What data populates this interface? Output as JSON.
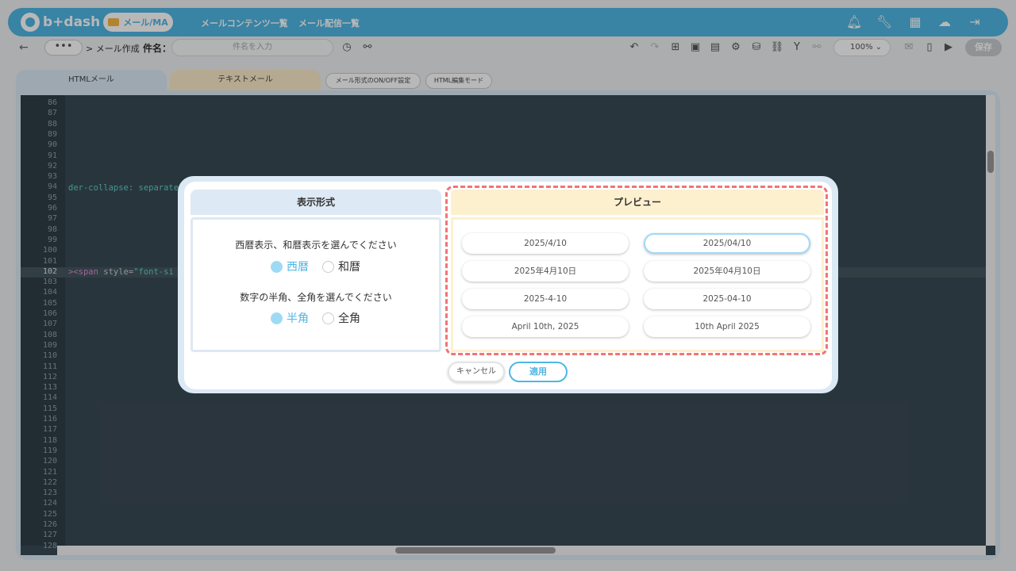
{
  "app": {
    "logo": "b+dash"
  },
  "topbar": {
    "mode": "メール/MA",
    "nav": [
      "メールコンテンツ一覧",
      "メール配信一覧"
    ],
    "icons": [
      "bell-icon",
      "wrench-icon",
      "grid-icon",
      "chat-icon",
      "logout-icon"
    ]
  },
  "toolbar": {
    "back": "←",
    "more": "•••",
    "breadcrumb": "> メール作成",
    "subject_label": "件名：",
    "subject_placeholder": "件名を入力",
    "zoom": "100%",
    "save": "保存"
  },
  "tabs": {
    "html": "HTMLメール",
    "text": "テキストメール",
    "format_toggle": "メール形式のON/OFF設定",
    "html_edit": "HTML編集モード"
  },
  "editor": {
    "line_numbers": [
      "86",
      "87",
      "88",
      "89",
      "90",
      "91",
      "92",
      "93",
      "94",
      "95",
      "96",
      "97",
      "98",
      "99",
      "100",
      "101",
      "102",
      "103",
      "104",
      "105",
      "106",
      "107",
      "108",
      "109",
      "110",
      "111",
      "112",
      "113",
      "114",
      "115",
      "116",
      "117",
      "118",
      "119",
      "120",
      "121",
      "122",
      "123",
      "124",
      "125",
      "126",
      "127",
      "128"
    ],
    "code_line_94": "der-collapse: separate",
    "code_line_102_tag": "><span",
    "code_line_102_attr": " style=",
    "code_line_102_val": "\"font-si"
  },
  "dialog": {
    "left_title": "表示形式",
    "q_era": "西暦表示、和暦表示を選んでください",
    "era_options": [
      "西暦",
      "和暦"
    ],
    "q_width": "数字の半角、全角を選んでください",
    "width_options": [
      "半角",
      "全角"
    ],
    "right_title": "プレビュー",
    "formats": [
      "2025/4/10",
      "2025/04/10",
      "2025年4月10日",
      "2025年04月10日",
      "2025-4-10",
      "2025-04-10",
      "April 10th, 2025",
      "10th April 2025"
    ],
    "selected_format": "2025/04/10",
    "cancel": "キャンセル",
    "apply": "適用"
  },
  "colors": {
    "accent": "#4fb6e3",
    "highlight_dash": "#f07575",
    "editor_bg": "#3a4a55"
  }
}
